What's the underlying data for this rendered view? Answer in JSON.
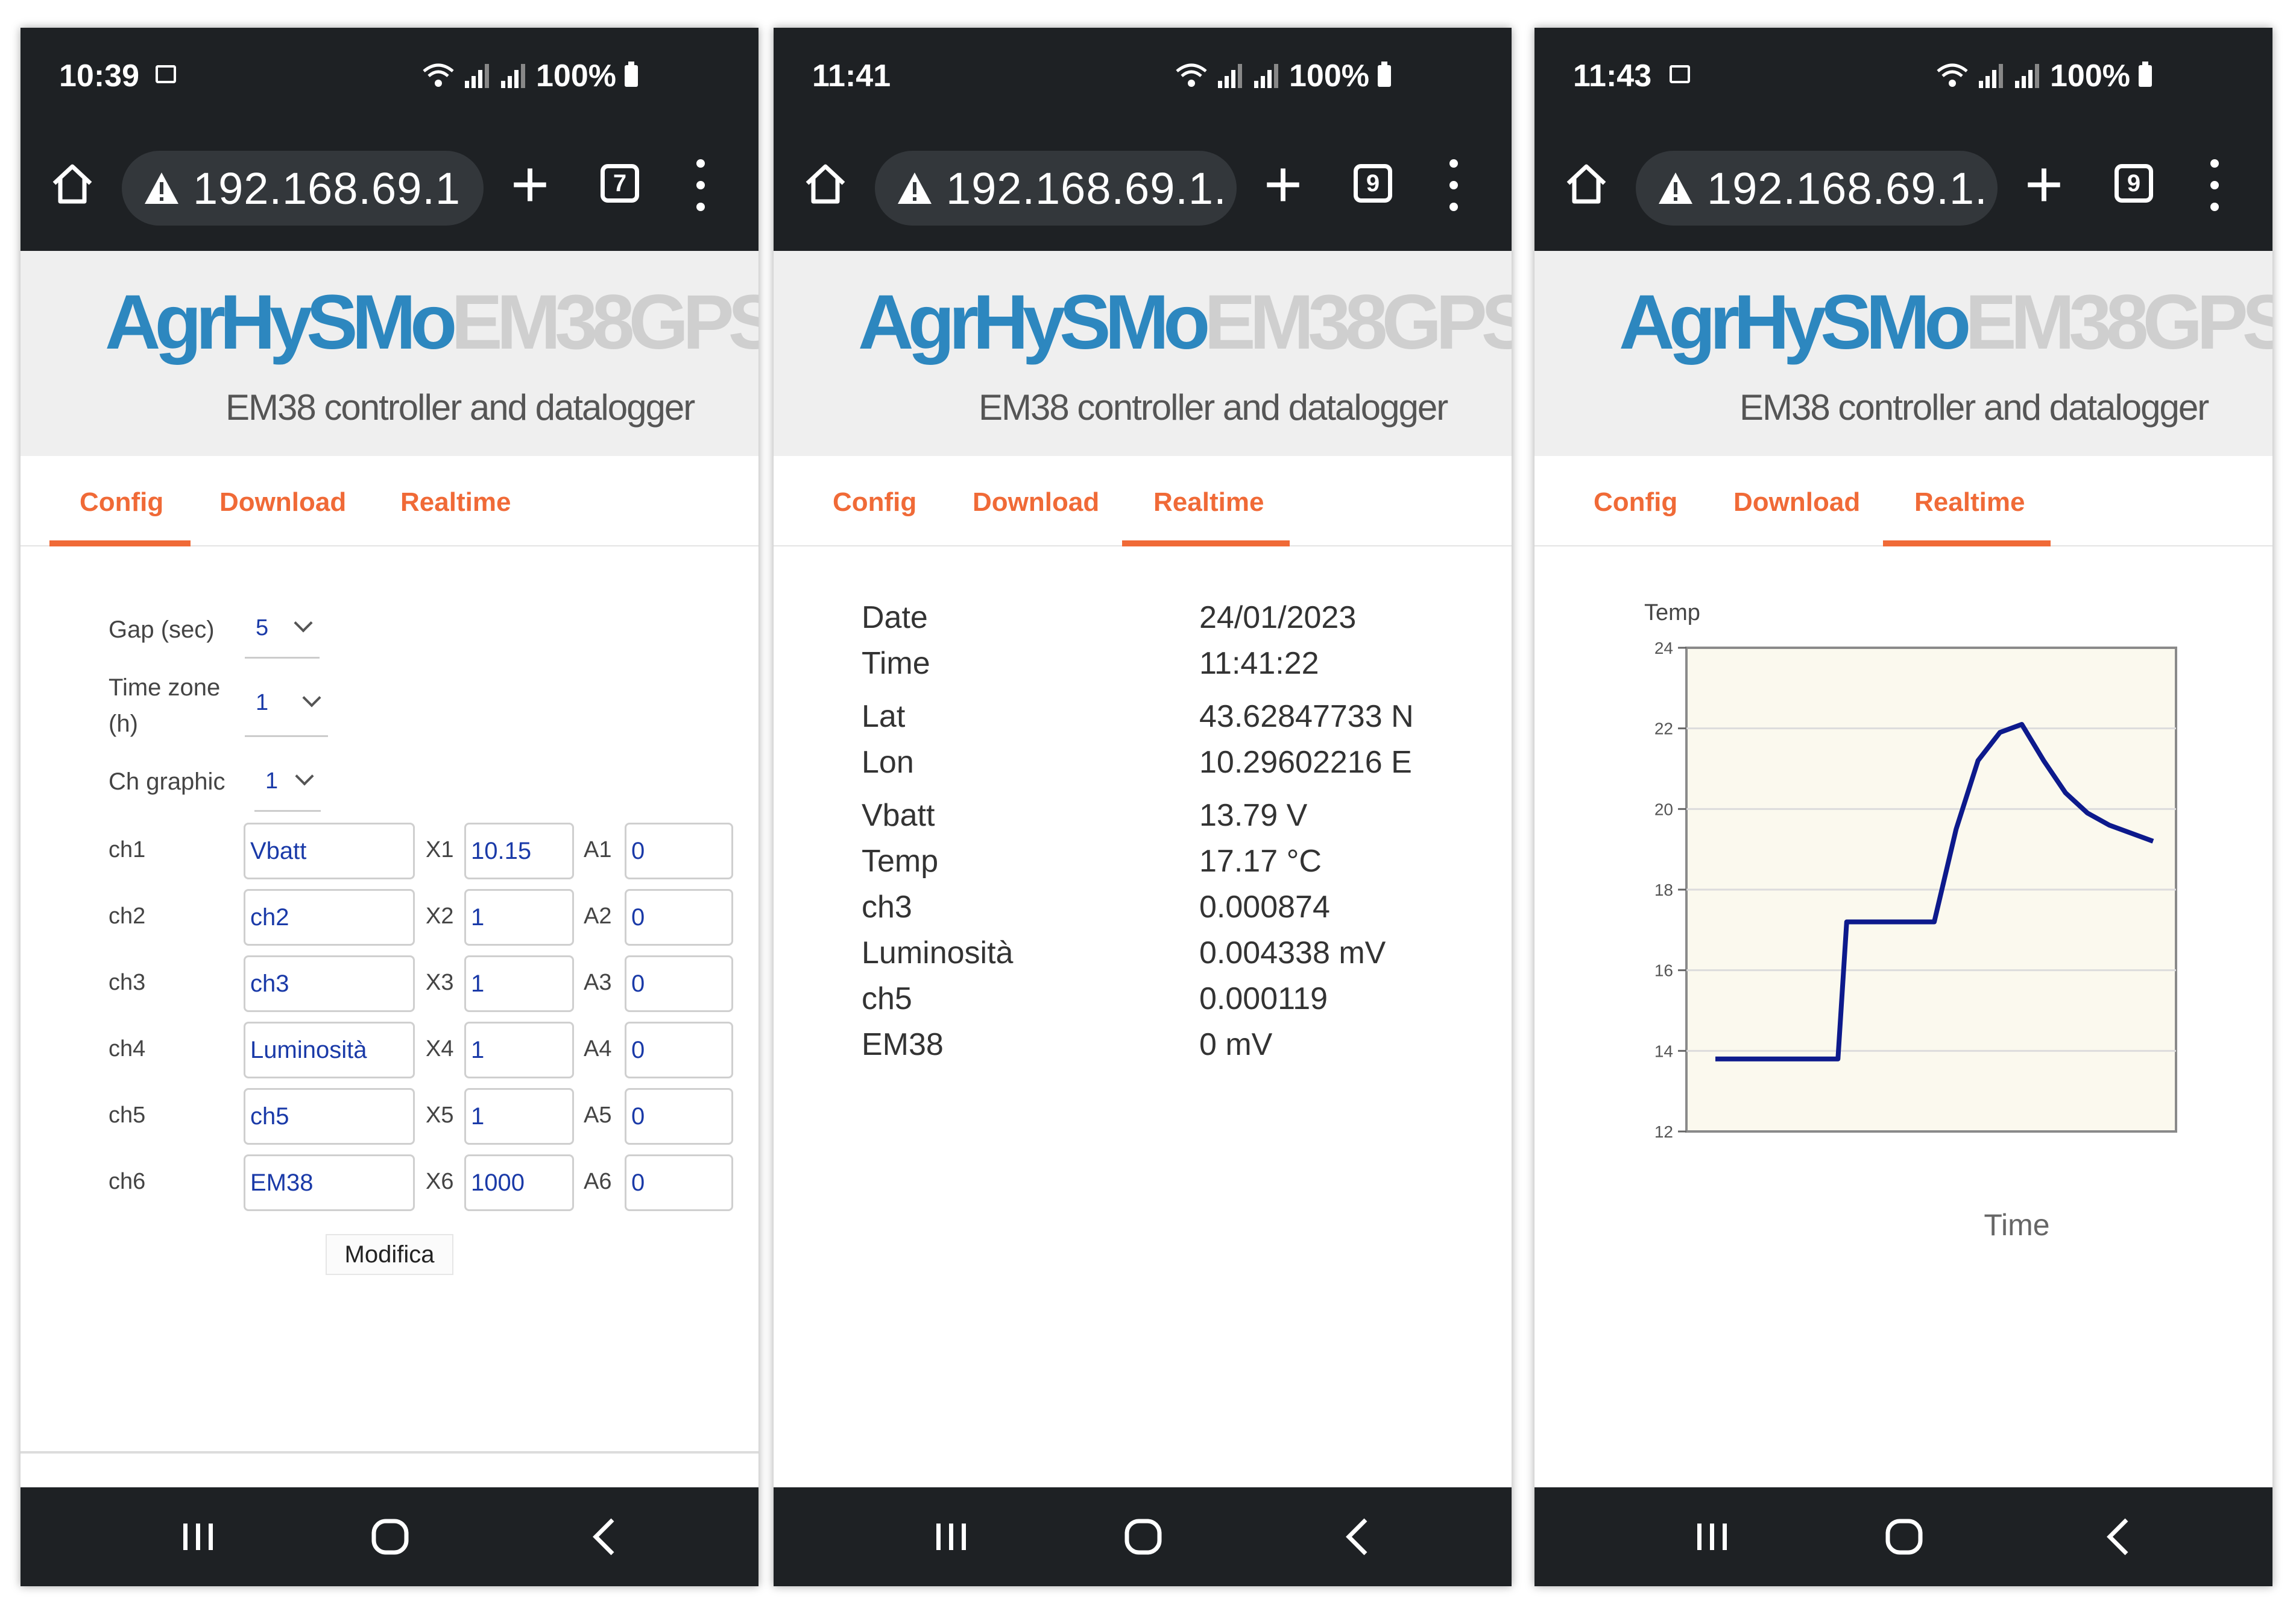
{
  "app": {
    "brand_primary": "AgrHySMo",
    "brand_secondary": "EM38GPS",
    "tagline": "EM38 controller and datalogger",
    "tabs": [
      "Config",
      "Download",
      "Realtime"
    ]
  },
  "colors": {
    "brand_blue": "#2d87bf",
    "brand_grey": "#cfcfcf",
    "tab_accent": "#f06a37",
    "system_bar": "#1e2124",
    "chart_line": "#0d1a8c",
    "chart_bg": "#fbf9ee"
  },
  "phones": [
    {
      "status": {
        "time": "10:39",
        "battery": "100%",
        "has_gallery_icon": true
      },
      "browser": {
        "url": "192.168.69.1",
        "tab_count": "7"
      },
      "active_tab": "Config"
    },
    {
      "status": {
        "time": "11:41",
        "battery": "100%",
        "has_gallery_icon": false
      },
      "browser": {
        "url": "192.168.69.1.",
        "tab_count": "9"
      },
      "active_tab": "Realtime"
    },
    {
      "status": {
        "time": "11:43",
        "battery": "100%",
        "has_gallery_icon": true
      },
      "browser": {
        "url": "192.168.69.1.",
        "tab_count": "9"
      },
      "active_tab": "Realtime"
    }
  ],
  "config": {
    "gap": {
      "label": "Gap (sec)",
      "value": "5"
    },
    "timezone": {
      "label_line1": "Time zone",
      "label_line2": "(h)",
      "value": "1"
    },
    "ch_graphic": {
      "label": "Ch graphic",
      "value": "1"
    },
    "channels": [
      {
        "label": "ch1",
        "name": "Vbatt",
        "x_label": "X1",
        "x": "10.15",
        "a_label": "A1",
        "a": "0"
      },
      {
        "label": "ch2",
        "name": "ch2",
        "x_label": "X2",
        "x": "1",
        "a_label": "A2",
        "a": "0"
      },
      {
        "label": "ch3",
        "name": "ch3",
        "x_label": "X3",
        "x": "1",
        "a_label": "A3",
        "a": "0"
      },
      {
        "label": "ch4",
        "name": "Luminosità",
        "x_label": "X4",
        "x": "1",
        "a_label": "A4",
        "a": "0"
      },
      {
        "label": "ch5",
        "name": "ch5",
        "x_label": "X5",
        "x": "1",
        "a_label": "A5",
        "a": "0"
      },
      {
        "label": "ch6",
        "name": "EM38",
        "x_label": "X6",
        "x": "1000",
        "a_label": "A6",
        "a": "0"
      }
    ],
    "submit_label": "Modifica"
  },
  "realtime": [
    {
      "label": "Date",
      "value": "24/01/2023"
    },
    {
      "label": "Time",
      "value": "11:41:22"
    },
    {
      "label": "Lat",
      "value": "43.62847733 N"
    },
    {
      "label": "Lon",
      "value": "10.29602216 E"
    },
    {
      "label": "Vbatt",
      "value": "13.79 V"
    },
    {
      "label": "Temp",
      "value": "17.17 °C"
    },
    {
      "label": "ch3",
      "value": "0.000874"
    },
    {
      "label": "Luminosità",
      "value": "0.004338 mV"
    },
    {
      "label": "ch5",
      "value": "0.000119"
    },
    {
      "label": "EM38",
      "value": "0 mV"
    }
  ],
  "chart_data": {
    "type": "line",
    "title": "",
    "xlabel": "Time",
    "ylabel": "Temp",
    "ylim": [
      12,
      24
    ],
    "yticks": [
      12,
      14,
      16,
      18,
      20,
      22,
      24
    ],
    "grid": true,
    "series": [
      {
        "x": [
          0,
          5,
          10,
          15,
          20,
          25,
          28,
          30,
          32,
          35,
          40,
          50,
          55,
          60,
          65,
          70,
          75,
          80,
          85,
          90,
          100
        ],
        "values": [
          13.8,
          13.8,
          13.8,
          13.8,
          13.8,
          13.8,
          13.8,
          17.2,
          17.2,
          17.2,
          17.2,
          17.2,
          19.5,
          21.2,
          21.9,
          22.1,
          21.2,
          20.4,
          19.9,
          19.6,
          19.2
        ]
      }
    ]
  }
}
